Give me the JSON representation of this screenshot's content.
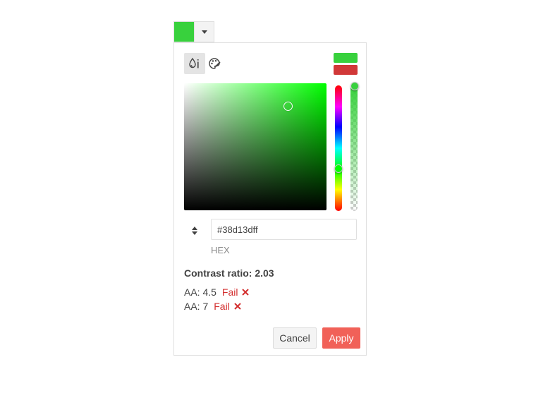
{
  "colors": {
    "current": "#38d13d",
    "previous": "#d13838",
    "hue": "#00ff00",
    "accent": "#f16158",
    "fail": "#d32f2f"
  },
  "picker": {
    "arrow_icon": "caret-down-icon"
  },
  "views": [
    {
      "name": "gradient-view-icon",
      "active": true
    },
    {
      "name": "palette-view-icon",
      "active": false
    }
  ],
  "input": {
    "value": "#38d13dff",
    "label": "HEX",
    "toggle_icon": "up-down-arrows-icon"
  },
  "contrast": {
    "title": "Contrast ratio: 2.03",
    "rows": [
      {
        "label": "AA: 4.5",
        "status": "Fail",
        "icon": "x-icon"
      },
      {
        "label": "AA: 7",
        "status": "Fail",
        "icon": "x-icon"
      }
    ]
  },
  "actions": {
    "cancel": "Cancel",
    "apply": "Apply"
  }
}
